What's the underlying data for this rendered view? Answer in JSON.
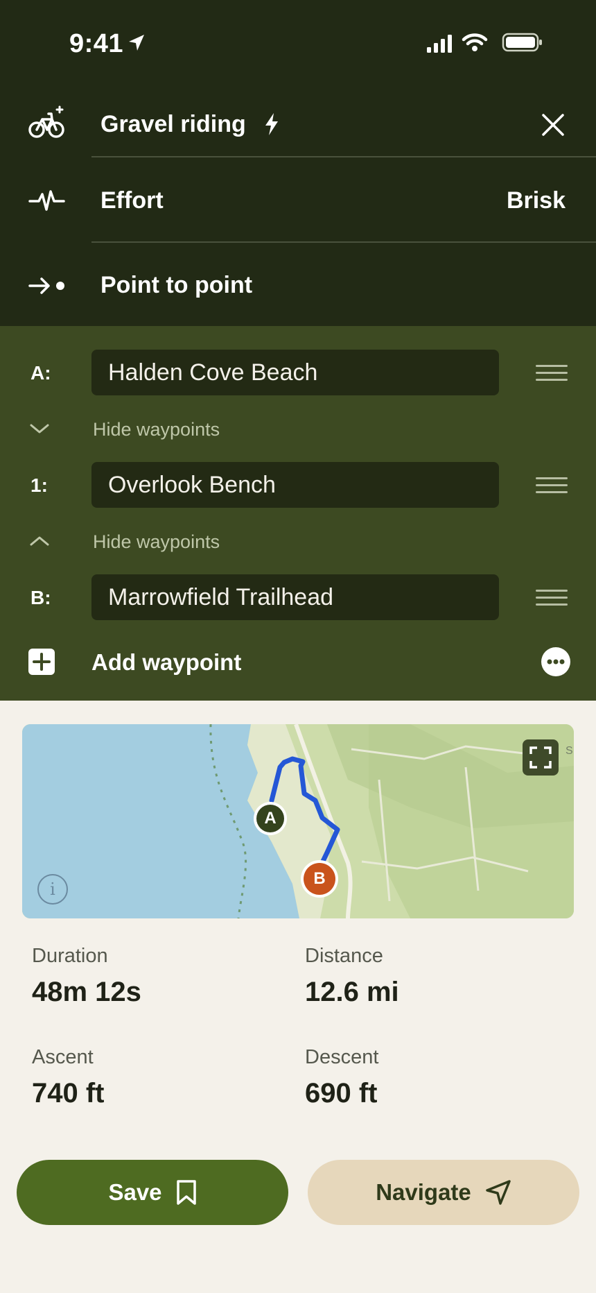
{
  "status_bar": {
    "time": "9:41"
  },
  "header": {
    "activity": "Gravel riding",
    "effort_label": "Effort",
    "effort_value": "Brisk",
    "route_mode": "Point to point"
  },
  "waypoints": {
    "start": {
      "key": "A:",
      "value": "Halden Cove Beach"
    },
    "middle": {
      "key": "1:",
      "value": "Overlook Bench"
    },
    "end": {
      "key": "B:",
      "value": "Marrowfield Trailhead"
    },
    "hide_label_1": "Hide waypoints",
    "hide_label_2": "Hide waypoints",
    "add_label": "Add waypoint"
  },
  "map": {
    "marker_a": "A",
    "marker_b": "B",
    "edge_text": "S",
    "info_glyph": "i"
  },
  "stats": {
    "duration_label": "Duration",
    "duration_value": "48m 12s",
    "distance_label": "Distance",
    "distance_value": "12.6 mi",
    "ascent_label": "Ascent",
    "ascent_value": "740 ft",
    "descent_label": "Descent",
    "descent_value": "690 ft"
  },
  "actions": {
    "save_label": "Save",
    "navigate_label": "Navigate"
  },
  "colors": {
    "header_bg": "#222a15",
    "waypoints_bg": "#3d4a22",
    "save_button": "#4e6b21",
    "navigate_button": "#e6d7bb",
    "route_line": "#2457d6",
    "marker_b": "#c9531c"
  },
  "icons": {
    "activity": "bike-icon",
    "effort": "heartbeat-icon",
    "route_mode": "arrow-to-point-icon",
    "close": "close-icon",
    "bolt": "bolt-icon",
    "drag": "drag-handle-icon",
    "add": "plus-square-icon",
    "more": "more-icon",
    "expand": "expand-icon",
    "info": "info-icon",
    "bookmark": "bookmark-icon",
    "navigate": "navigation-arrow-icon"
  }
}
